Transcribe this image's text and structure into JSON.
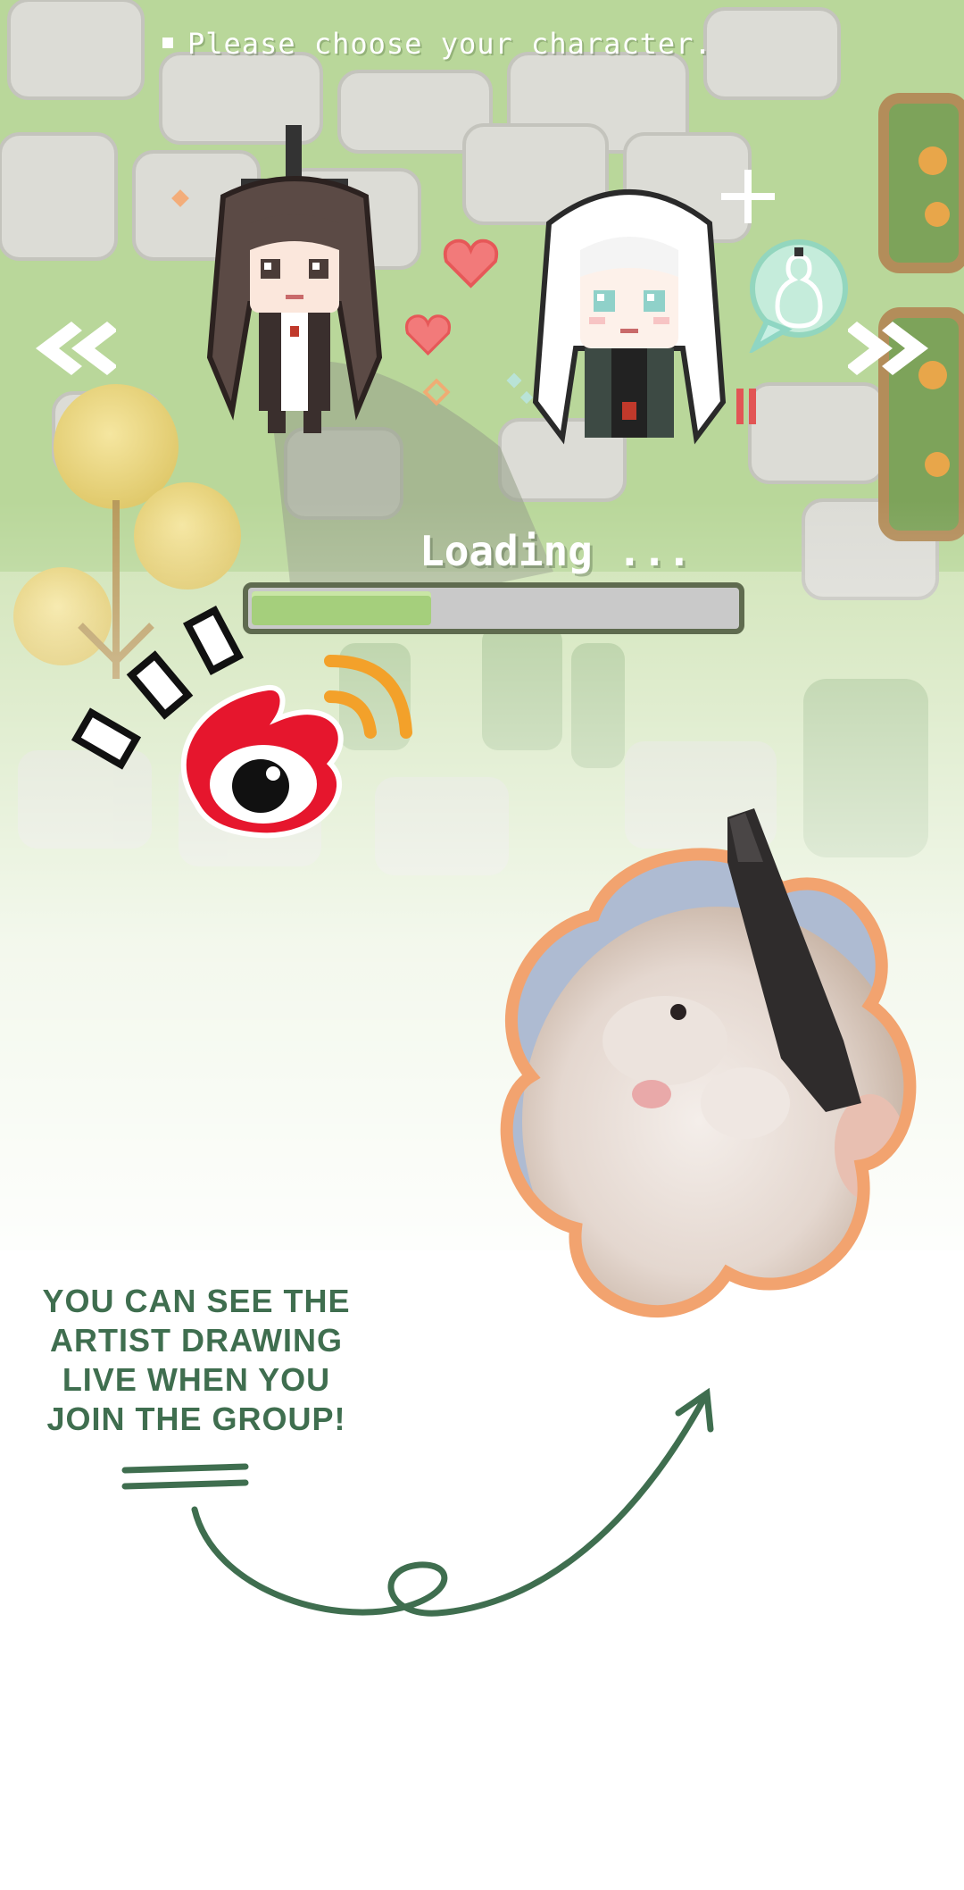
{
  "game": {
    "prompt": "Please choose your character.",
    "loading_label": "Loading ...",
    "loading_progress": 0.37,
    "nav": {
      "prev": "prev-character",
      "next": "next-character"
    },
    "characters": [
      {
        "id": "left",
        "hair": "dark"
      },
      {
        "id": "right",
        "hair": "white"
      }
    ]
  },
  "promo": {
    "caption_lines": [
      "YOU CAN SEE THE",
      "ARTIST DRAWING",
      "LIVE WHEN YOU",
      "JOIN THE GROUP!"
    ],
    "logo": "weibo-logo-icon",
    "photo": "hamster-photo"
  },
  "colors": {
    "grass": "#a8cf7a",
    "stone": "#d8d8d3",
    "bar_fill": "#a5cf7c",
    "caption": "#3f6e4f",
    "arrow": "#3f6e4f",
    "photo_border": "#f2a36f",
    "weibo_red": "#e6162d",
    "weibo_orange": "#f3a12a"
  }
}
